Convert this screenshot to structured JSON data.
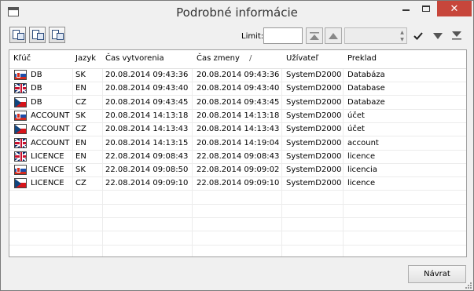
{
  "window": {
    "title": "Podrobné informácie",
    "close_glyph": "✕",
    "close_color": "#c7463b"
  },
  "toolbar": {
    "limit_label": "Limit:",
    "limit_value": "",
    "icons": [
      "export-icon",
      "export-selected-icon",
      "copy-icon"
    ]
  },
  "table": {
    "columns": [
      "Kľúč",
      "Jazyk",
      "Čas vytvorenia",
      "Čas zmeny",
      "Užívateľ",
      "Preklad"
    ],
    "sort_indicator": "/",
    "rows": [
      {
        "flag": "sk",
        "key": "DB",
        "lang": "SK",
        "created": "20.08.2014 09:43:36",
        "changed": "20.08.2014 09:43:36",
        "user": "SystemD2000",
        "translation": "Databáza"
      },
      {
        "flag": "en",
        "key": "DB",
        "lang": "EN",
        "created": "20.08.2014 09:43:40",
        "changed": "20.08.2014 09:43:40",
        "user": "SystemD2000",
        "translation": "Database"
      },
      {
        "flag": "cz",
        "key": "DB",
        "lang": "CZ",
        "created": "20.08.2014 09:43:45",
        "changed": "20.08.2014 09:43:45",
        "user": "SystemD2000",
        "translation": "Databaze"
      },
      {
        "flag": "sk",
        "key": "ACCOUNT",
        "lang": "SK",
        "created": "20.08.2014 14:13:18",
        "changed": "20.08.2014 14:13:18",
        "user": "SystemD2000",
        "translation": "účet"
      },
      {
        "flag": "cz",
        "key": "ACCOUNT",
        "lang": "CZ",
        "created": "20.08.2014 14:13:43",
        "changed": "20.08.2014 14:13:43",
        "user": "SystemD2000",
        "translation": "účet"
      },
      {
        "flag": "en",
        "key": "ACCOUNT",
        "lang": "EN",
        "created": "20.08.2014 14:13:15",
        "changed": "20.08.2014 14:19:04",
        "user": "SystemD2000",
        "translation": "account"
      },
      {
        "flag": "en",
        "key": "LICENCE",
        "lang": "EN",
        "created": "22.08.2014 09:08:43",
        "changed": "22.08.2014 09:08:43",
        "user": "SystemD2000",
        "translation": "licence"
      },
      {
        "flag": "sk",
        "key": "LICENCE",
        "lang": "SK",
        "created": "22.08.2014 09:08:50",
        "changed": "22.08.2014 09:09:02",
        "user": "SystemD2000",
        "translation": "licencia"
      },
      {
        "flag": "cz",
        "key": "LICENCE",
        "lang": "CZ",
        "created": "22.08.2014 09:09:10",
        "changed": "22.08.2014 09:09:10",
        "user": "SystemD2000",
        "translation": "licence"
      }
    ]
  },
  "footer": {
    "back_label": "Návrat"
  }
}
